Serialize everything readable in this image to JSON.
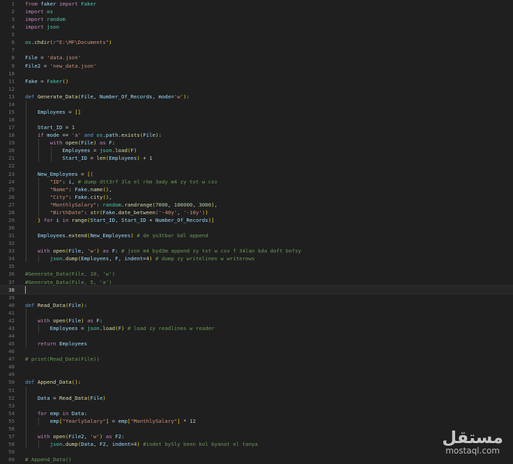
{
  "editor": {
    "current_line": 38,
    "lines": [
      {
        "n": "1",
        "t": "from faker import Faker"
      },
      {
        "n": "2",
        "t": "import os"
      },
      {
        "n": "3",
        "t": "import random"
      },
      {
        "n": "4",
        "t": "import json"
      },
      {
        "n": "5",
        "t": ""
      },
      {
        "n": "6",
        "t": "os.chdir(r\"E:\\MF\\Documents\")"
      },
      {
        "n": "7",
        "t": ""
      },
      {
        "n": "8",
        "t": "File = 'data.json'"
      },
      {
        "n": "9",
        "t": "File2 = 'new_data.json'"
      },
      {
        "n": "10",
        "t": ""
      },
      {
        "n": "11",
        "t": "Fake = Faker()"
      },
      {
        "n": "12",
        "t": ""
      },
      {
        "n": "13",
        "t": "def Generate_Data(File, Number_Of_Records, mode='w'):"
      },
      {
        "n": "14",
        "t": ""
      },
      {
        "n": "15",
        "t": "    Employees = []"
      },
      {
        "n": "16",
        "t": ""
      },
      {
        "n": "17",
        "t": "    Start_ID = 1"
      },
      {
        "n": "18",
        "t": "    if mode == 'a' and os.path.exists(File):"
      },
      {
        "n": "19",
        "t": "        with open(File) as F:"
      },
      {
        "n": "20",
        "t": "            Employees = json.load(F)"
      },
      {
        "n": "21",
        "t": "            Start_ID = len(Employees) + 1"
      },
      {
        "n": "22",
        "t": ""
      },
      {
        "n": "23",
        "t": "    New_Employees = [{"
      },
      {
        "n": "24",
        "t": "        \"ID\": i, # dump dtt3rf 3la el rkm 3ady m4 zy txt w csv"
      },
      {
        "n": "25",
        "t": "        \"Name\": Fake.name(),"
      },
      {
        "n": "26",
        "t": "        \"City\": Fake.city(),"
      },
      {
        "n": "27",
        "t": "        \"MonthlySalary\": random.randrange(7000, 100000, 3000),"
      },
      {
        "n": "28",
        "t": "        \"BirthDate\": str(Fake.date_between('-40y', '-10y'))"
      },
      {
        "n": "29",
        "t": "    } for i in range(Start_ID, Start_ID + Number_Of_Records)]"
      },
      {
        "n": "30",
        "t": ""
      },
      {
        "n": "31",
        "t": "    Employees.extend(New_Employees) # de yo3tbar bdl append"
      },
      {
        "n": "32",
        "t": ""
      },
      {
        "n": "33",
        "t": "    with open(File, 'w') as F: # json m4 byd3m append zy txt w csv f 34lan kda doft bnfsy"
      },
      {
        "n": "34",
        "t": "        json.dump(Employees, F, indent=4) # dump zy writelines w writerows"
      },
      {
        "n": "35",
        "t": ""
      },
      {
        "n": "36",
        "t": "#Generate_Data(File, 10, 'w')"
      },
      {
        "n": "37",
        "t": "#Generate_Data(File, 5, 'a')"
      },
      {
        "n": "38",
        "t": ""
      },
      {
        "n": "39",
        "t": ""
      },
      {
        "n": "40",
        "t": "def Read_Data(File):"
      },
      {
        "n": "41",
        "t": ""
      },
      {
        "n": "42",
        "t": "    with open(File) as F:"
      },
      {
        "n": "43",
        "t": "        Employees = json.load(F) # load zy readlines w reader"
      },
      {
        "n": "44",
        "t": ""
      },
      {
        "n": "45",
        "t": "    return Employees"
      },
      {
        "n": "46",
        "t": ""
      },
      {
        "n": "47",
        "t": "# print(Read_Data(File))"
      },
      {
        "n": "48",
        "t": ""
      },
      {
        "n": "49",
        "t": ""
      },
      {
        "n": "50",
        "t": "def Append_Data():"
      },
      {
        "n": "51",
        "t": ""
      },
      {
        "n": "52",
        "t": "    Data = Read_Data(File)"
      },
      {
        "n": "53",
        "t": ""
      },
      {
        "n": "54",
        "t": "    for emp in Data:"
      },
      {
        "n": "55",
        "t": "        emp[\"YearlySalary\"] = emp[\"MonthlySalary\"] * 12"
      },
      {
        "n": "56",
        "t": ""
      },
      {
        "n": "57",
        "t": "    with open(File2, 'w') as F2:"
      },
      {
        "n": "58",
        "t": "        json.dump(Data, F2, indent=4) #indet bySly been kol byanat el tanya"
      },
      {
        "n": "59",
        "t": ""
      },
      {
        "n": "60",
        "t": "# Append_Data()"
      }
    ]
  },
  "watermark": {
    "arabic": "مستقل",
    "latin": "mostaql.com"
  },
  "colors": {
    "background": "#1f1f1f",
    "line_number": "#6e7681",
    "keyword_control": "#c586c0",
    "keyword": "#569cd6",
    "function": "#dcdcaa",
    "variable": "#9cdcfe",
    "string": "#ce9178",
    "number": "#b5cea8",
    "comment": "#6a9955",
    "class": "#4ec9b0"
  }
}
